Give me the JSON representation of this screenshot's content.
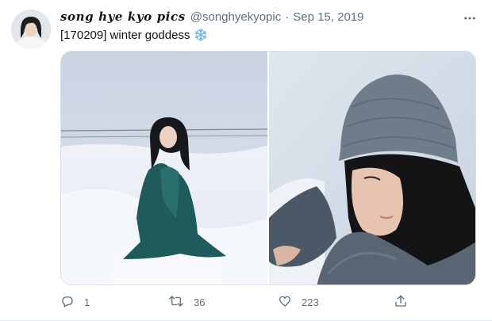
{
  "tweet": {
    "display_name": "song hye kyo pics",
    "handle": "@songhyekyopic",
    "separator": "·",
    "date": "Sep 15, 2019",
    "text": "[170209] winter goddess",
    "emoji_icon": "snowflake-icon"
  },
  "actions": {
    "reply_count": "1",
    "retweet_count": "36",
    "like_count": "223"
  },
  "colors": {
    "secondary_text": "#5b7083",
    "snowflake": "#6fb7e6"
  }
}
